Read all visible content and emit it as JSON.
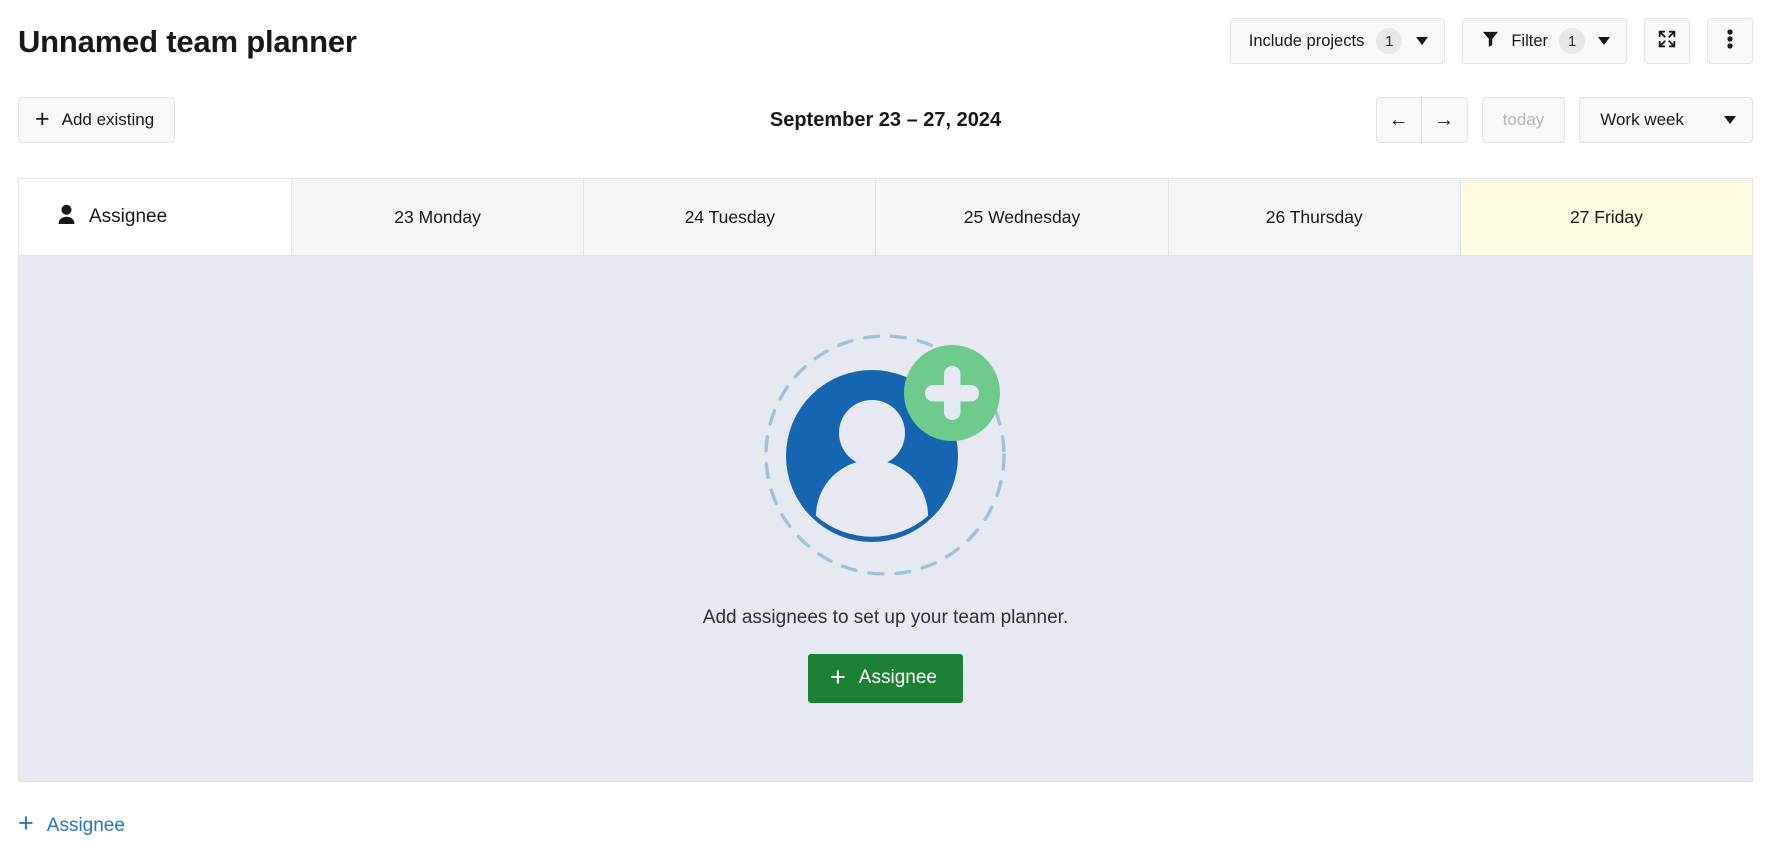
{
  "header": {
    "title": "Unnamed team planner",
    "include_projects": {
      "label": "Include projects",
      "count": "1",
      "caret_icon": "chevron-down-icon"
    },
    "filter": {
      "label": "Filter",
      "count": "1",
      "icon": "funnel-icon",
      "caret_icon": "chevron-down-icon"
    },
    "fullscreen": {
      "icon": "fullscreen-expand-icon"
    },
    "more": {
      "icon": "vertical-ellipsis-icon"
    }
  },
  "toolbar": {
    "add_existing": {
      "label": "Add existing",
      "icon": "plus-icon"
    },
    "date_range": "September 23 – 27, 2024",
    "prev": {
      "icon": "arrow-left-icon",
      "label": "←"
    },
    "next": {
      "icon": "arrow-right-icon",
      "label": "→"
    },
    "today": {
      "label": "today",
      "disabled": "true"
    },
    "view_select": {
      "value": "Work week",
      "caret_icon": "chevron-down-icon"
    }
  },
  "calendar": {
    "assignee_column": {
      "label": "Assignee",
      "icon": "person-icon"
    },
    "days": [
      {
        "label": "23 Monday",
        "today": "false"
      },
      {
        "label": "24 Tuesday",
        "today": "false"
      },
      {
        "label": "25 Wednesday",
        "today": "false"
      },
      {
        "label": "26 Thursday",
        "today": "false"
      },
      {
        "label": "27 Friday",
        "today": "true"
      }
    ],
    "empty_state": {
      "illustration": "add-person-illustration",
      "message": "Add assignees to set up your team planner.",
      "button": {
        "label": "Assignee",
        "icon": "plus-icon"
      }
    }
  },
  "footer": {
    "add_assignee": {
      "label": "Assignee",
      "icon": "plus-icon"
    }
  },
  "colors": {
    "primary_green": "#1e8035",
    "link_blue": "#2376b7",
    "today_highlight": "#fcfbdf",
    "grid_background": "#e6e9f2",
    "border": "#dfe2e6",
    "illustration_blue": "#1565b0",
    "illustration_green": "#6ecb8b",
    "illustration_dash": "#9cc3d8"
  }
}
